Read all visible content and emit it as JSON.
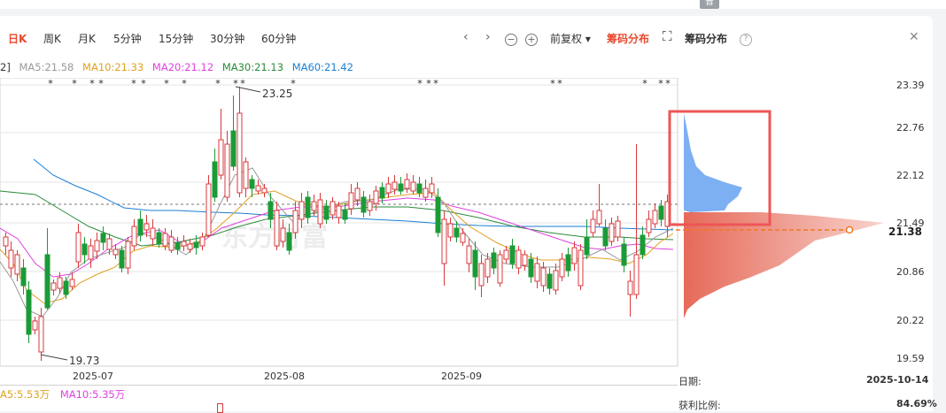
{
  "topbar": {
    "badge": "普"
  },
  "toolbar": {
    "tabs": [
      "日K",
      "周K",
      "月K",
      "5分钟",
      "15分钟",
      "30分钟",
      "60分钟"
    ],
    "active_tab": "日K",
    "adjust": "前复权 ▾",
    "chip_toggle": "筹码分布",
    "panel_title": "筹码分布",
    "prev_icon": "‹",
    "next_icon": "›",
    "zoom_out_icon": "−",
    "zoom_in_icon": "+",
    "expand_icon": "⛶",
    "help_icon": "?",
    "close_icon": "✕"
  },
  "ma_legend": {
    "prefix": "2]",
    "ma5": "MA5:21.58",
    "ma10": "MA10:21.33",
    "ma20": "MA20:21.12",
    "ma30": "MA30:21.13",
    "ma60": "MA60:21.42"
  },
  "colors": {
    "up": "#d9393c",
    "down": "#1a9b36",
    "ma5": "#999999",
    "ma10": "#e0a020",
    "ma20": "#e040e0",
    "ma30": "#2a8a3a",
    "ma60": "#1a7fd4",
    "accent": "#e8492d",
    "chip_profit": "#e87a6a",
    "chip_loss": "#6fa6f2",
    "highlight_box": "#ee5555"
  },
  "y_axis": [
    "23.39",
    "22.76",
    "22.12",
    "21.49",
    "20.86",
    "20.22",
    "19.59"
  ],
  "x_axis": [
    "2025-07",
    "2025-08",
    "2025-09"
  ],
  "annotations": {
    "high": "23.25",
    "low": "19.73"
  },
  "current_price": "21.38",
  "watermark": "东方财富",
  "volume_legend": {
    "prefix": "A5:5.53万",
    "ma10": "MA10:5.35万"
  },
  "chip_info": {
    "date_label": "日期:",
    "date_value": "2025-10-14",
    "profit_label": "获利比例:",
    "profit_value": "84.69%"
  }
}
